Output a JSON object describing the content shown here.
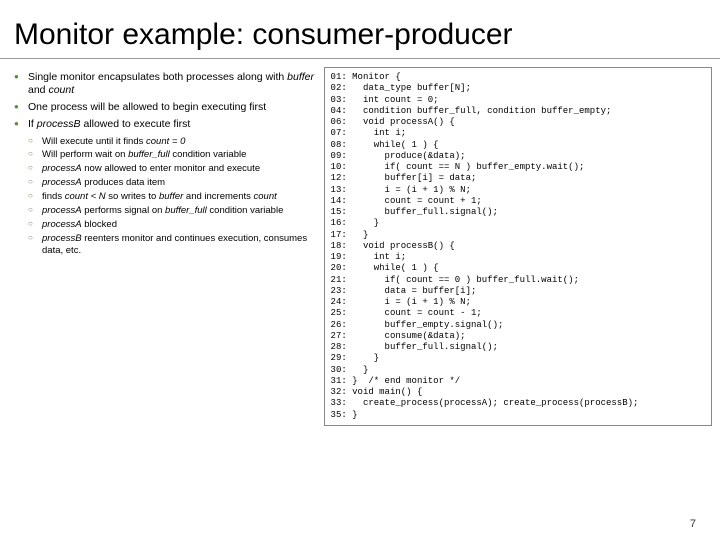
{
  "title": "Monitor example: consumer-producer",
  "bullets": [
    "Single monitor encapsulates both processes along with <span class=\"em\">buffer</span> and <span class=\"em\">count</span>",
    "One process will be allowed to begin executing first",
    "If <span class=\"em\">processB</span> allowed to execute first"
  ],
  "sub": [
    "Will execute until it finds <span class=\"em\">count = 0</span>",
    "Will perform wait on <span class=\"em\">buffer_full</span> condition variable",
    "<span class=\"em\">processA</span> now allowed to enter monitor and execute",
    "<span class=\"em\">processA</span> produces data item",
    "finds <span class=\"em\">count &lt; N</span> so writes to <span class=\"em\">buffer</span> and increments <span class=\"em\">count</span>",
    "<span class=\"em\">processA</span> performs signal on <span class=\"em\">buffer_full</span> condition variable",
    "<span class=\"em\">processA</span> blocked",
    "<span class=\"em\">processB</span> reenters monitor and continues execution, consumes data, etc."
  ],
  "code": "01: Monitor {\n02:   data_type buffer[N];\n03:   int count = 0;\n04:   condition buffer_full, condition buffer_empty;\n06:   void processA() {\n07:     int i;\n08:     while( 1 ) {\n09:       produce(&data);\n10:       if( count == N ) buffer_empty.wait();\n12:       buffer[i] = data;\n13:       i = (i + 1) % N;\n14:       count = count + 1;\n15:       buffer_full.signal();\n16:     }\n17:   }\n18:   void processB() {\n19:     int i;\n20:     while( 1 ) {\n21:       if( count == 0 ) buffer_full.wait();\n23:       data = buffer[i];\n24:       i = (i + 1) % N;\n25:       count = count - 1;\n26:       buffer_empty.signal();\n27:       consume(&data);\n28:       buffer_full.signal();\n29:     }\n30:   }\n31: }  /* end monitor */\n32: void main() {\n33:   create_process(processA); create_process(processB);\n35: }",
  "pagenum": "7"
}
